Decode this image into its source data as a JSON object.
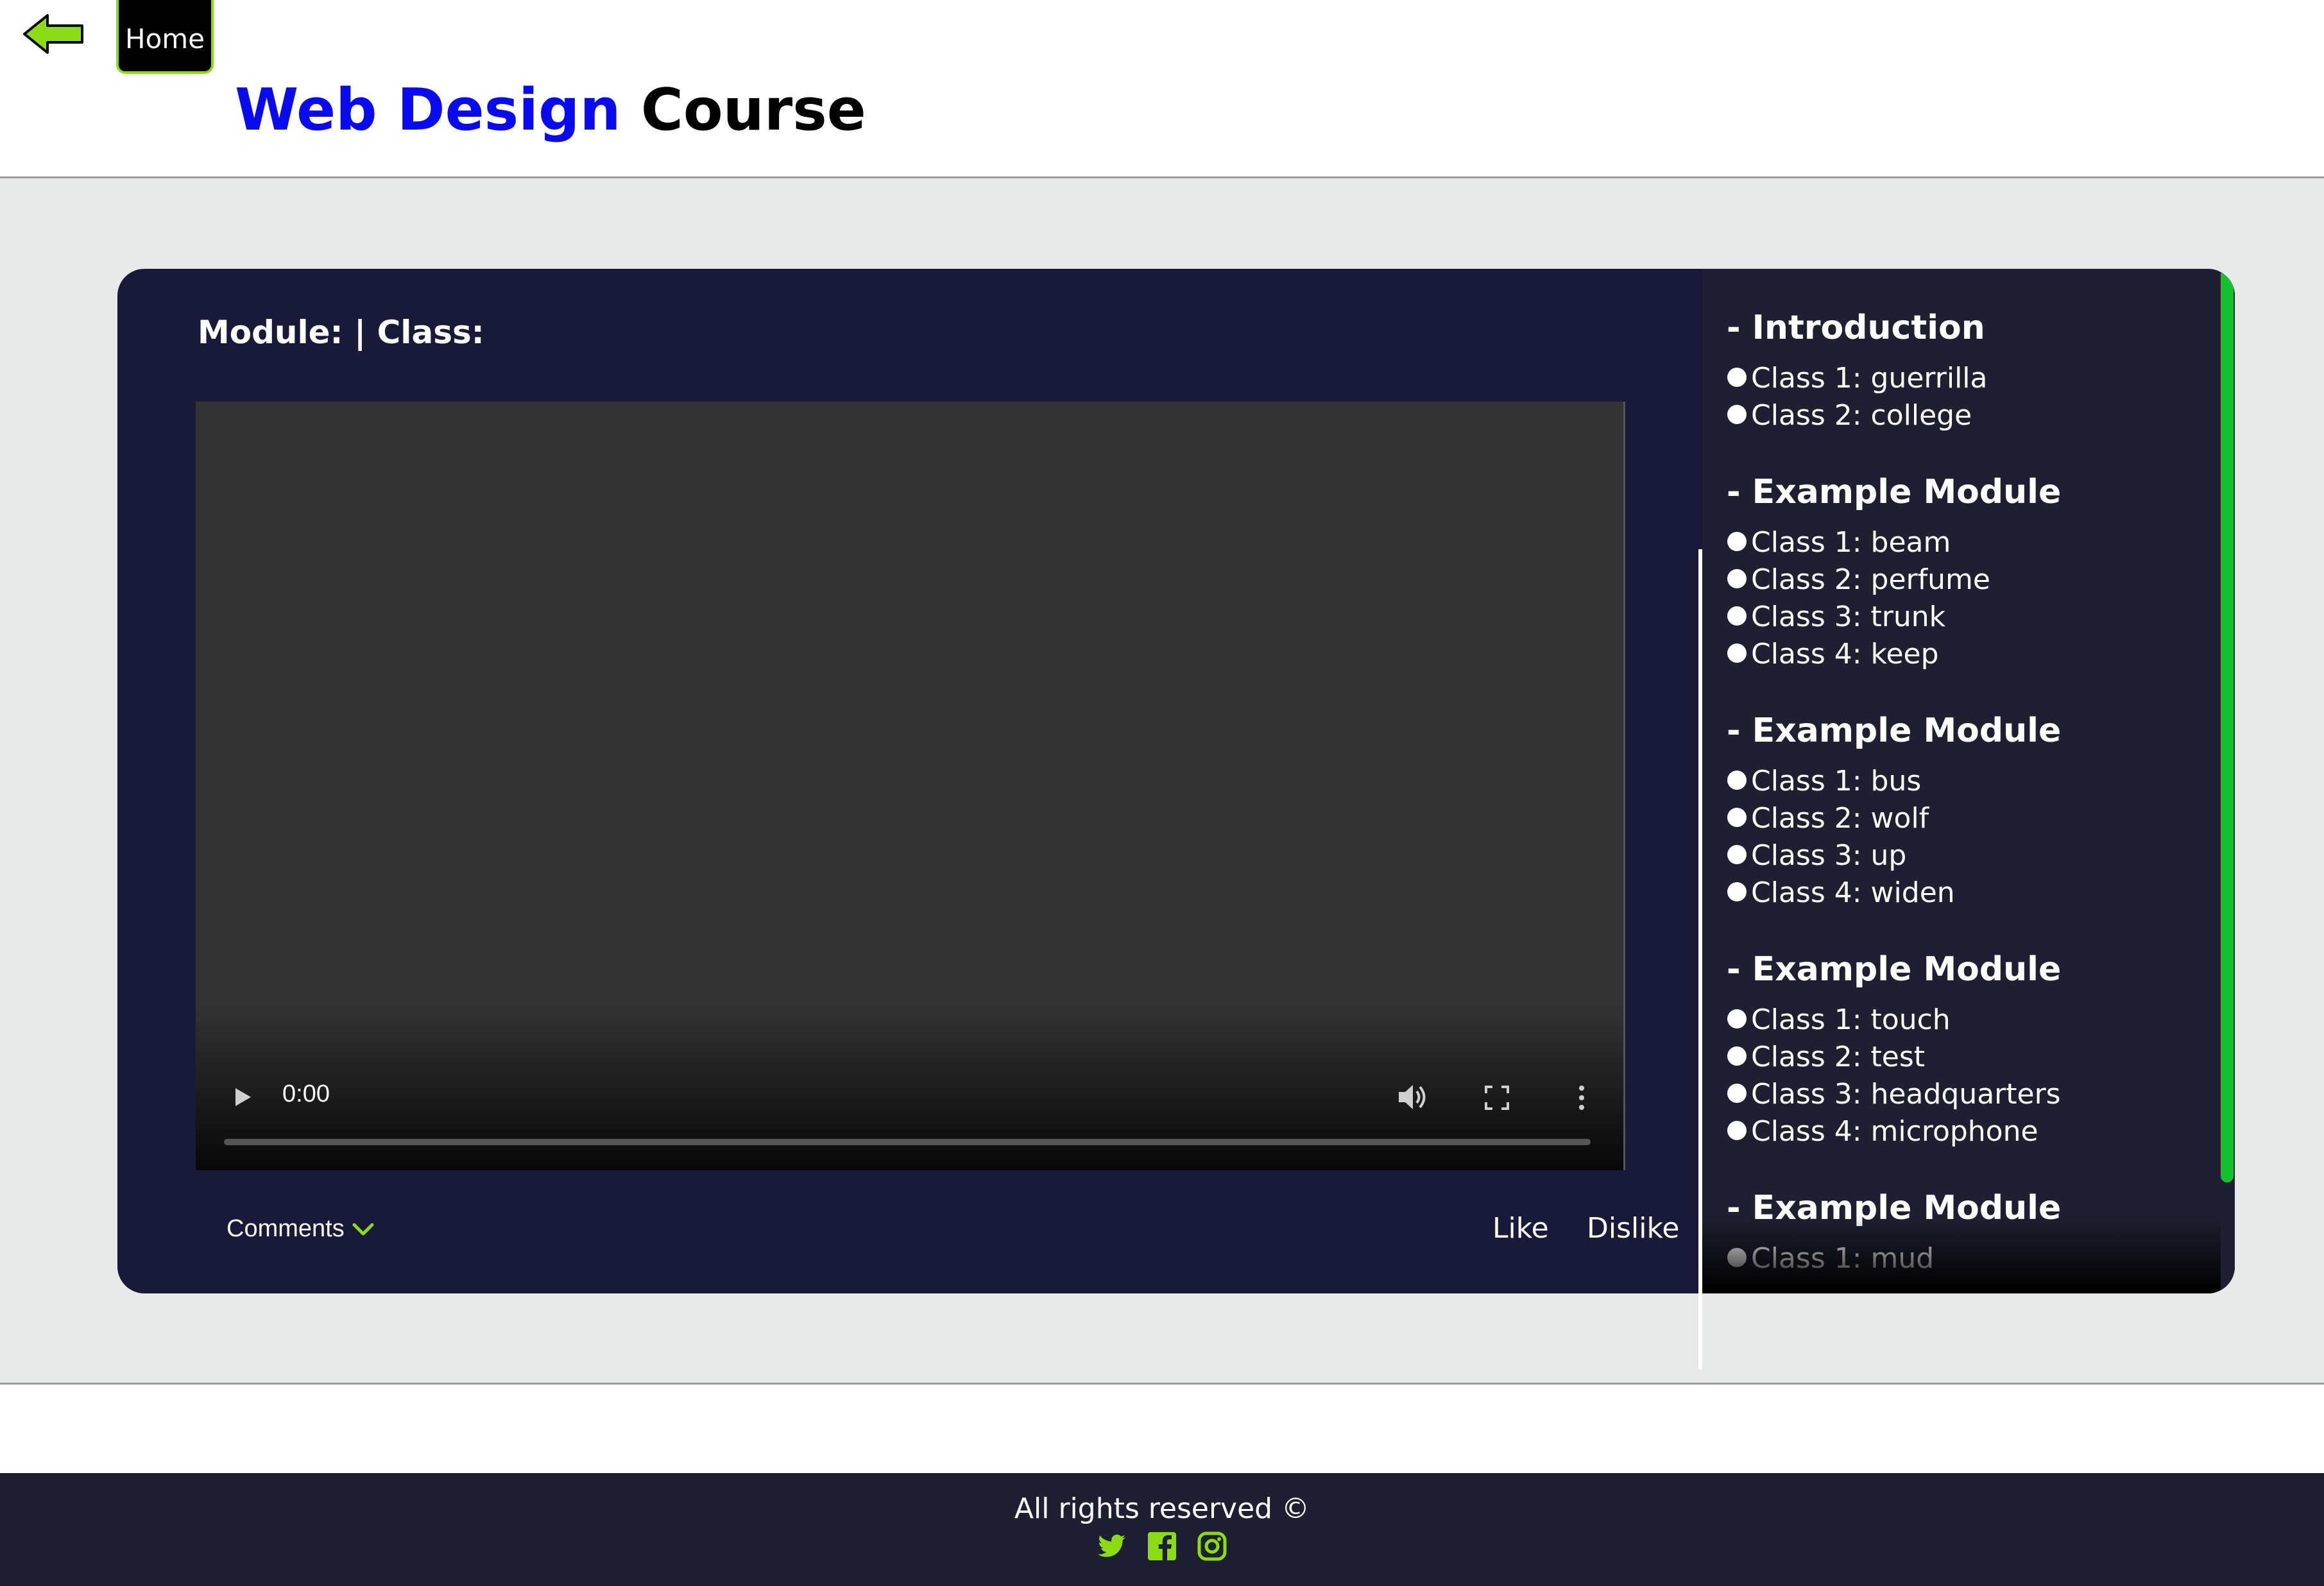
{
  "header": {
    "home_label": "Home",
    "title_accent": "Web Design",
    "title_rest": "Course"
  },
  "player": {
    "heading": "Module: | Class:",
    "time": "0:00",
    "progress": 0
  },
  "actions": {
    "comments_label": "Comments",
    "like_label": "Like",
    "dislike_label": "Dislike"
  },
  "modules": [
    {
      "title": "- Introduction",
      "classes": [
        "Class 1: guerrilla",
        "Class 2: college"
      ]
    },
    {
      "title": "- Example Module",
      "classes": [
        "Class 1: beam",
        "Class 2: perfume",
        "Class 3: trunk",
        "Class 4: keep"
      ]
    },
    {
      "title": "- Example Module",
      "classes": [
        "Class 1: bus",
        "Class 2: wolf",
        "Class 3: up",
        "Class 4: widen"
      ]
    },
    {
      "title": "- Example Module",
      "classes": [
        "Class 1: touch",
        "Class 2: test",
        "Class 3: headquarters",
        "Class 4: microphone"
      ]
    },
    {
      "title": "- Example Module",
      "classes": [
        "Class 1: mud"
      ]
    }
  ],
  "footer": {
    "copyright": "All rights reserved ©",
    "social_icons": [
      "twitter-icon",
      "facebook-icon",
      "instagram-icon"
    ]
  },
  "colors": {
    "accent_green": "#8bdc15",
    "title_blue": "#0a0aee",
    "card_bg": "#191a39",
    "sidebar_bg": "#1e1f30",
    "scrollbar_green": "#16c030",
    "page_bg": "#e8eaea"
  }
}
